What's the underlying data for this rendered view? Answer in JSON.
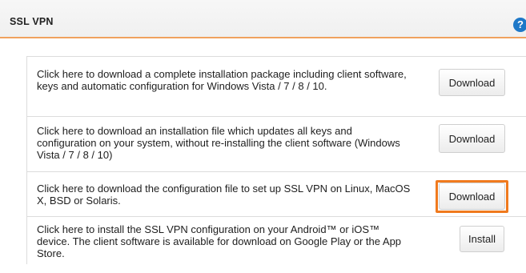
{
  "header": {
    "title": "SSL VPN",
    "help_icon_glyph": "?"
  },
  "rows": [
    {
      "text": "Click here to download a complete installation package including client software, keys and automatic configuration for Windows Vista / 7 / 8 / 10.",
      "button_label": "Download"
    },
    {
      "text": "Click here to download an installation file which updates all keys and configuration on your system, without re-installing the client software (Windows Vista / 7 / 8 / 10)",
      "button_label": "Download"
    },
    {
      "text": "Click here to download the configuration file to set up SSL VPN on Linux, MacOS X, BSD or Solaris.",
      "button_label": "Download"
    },
    {
      "text": "Click here to install the SSL VPN configuration on your Android™ or iOS™ device. The client software is available for download on Google Play or the App Store.",
      "button_label": "Install"
    }
  ],
  "colors": {
    "header_underline": "#f0a15e",
    "highlight": "#f07a1e",
    "help_icon": "#1e78c8"
  }
}
